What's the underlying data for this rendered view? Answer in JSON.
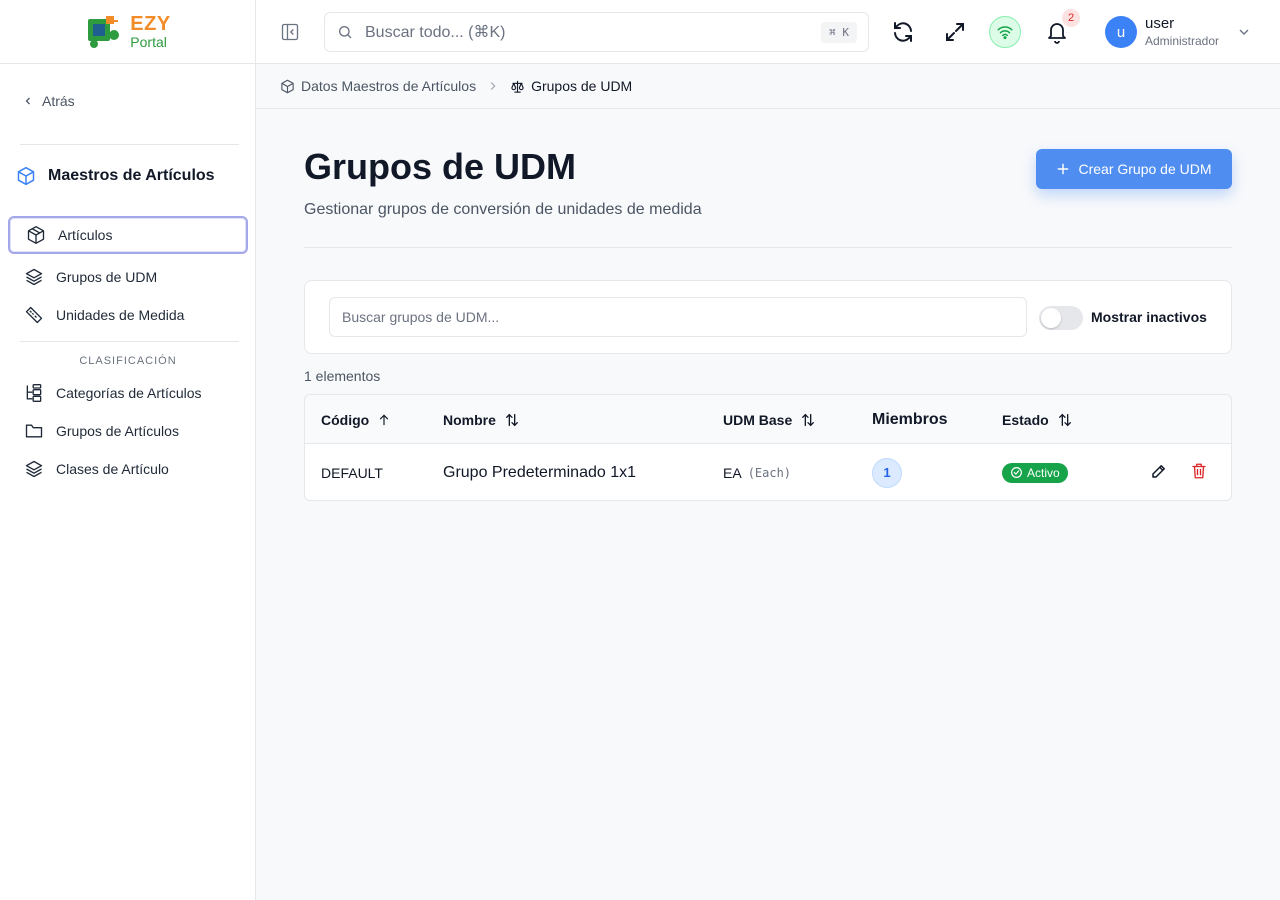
{
  "logo": {
    "line1": "EZY",
    "line2": "Portal"
  },
  "sidebar": {
    "back_label": "Atrás",
    "section_title": "Maestros de Artículos",
    "items": [
      {
        "label": "Artículos",
        "icon": "box-icon",
        "active": true
      },
      {
        "label": "Grupos de UDM",
        "icon": "layers-icon"
      },
      {
        "label": "Unidades de Medida",
        "icon": "ruler-icon"
      }
    ],
    "classification_label": "CLASIFICACIÓN",
    "classification_items": [
      {
        "label": "Categorías de Artículos",
        "icon": "hierarchy-icon"
      },
      {
        "label": "Grupos de Artículos",
        "icon": "folder-icon"
      },
      {
        "label": "Clases de Artículo",
        "icon": "layers-icon"
      }
    ]
  },
  "header": {
    "search_placeholder": "Buscar todo... (⌘K)",
    "shortcut": "⌘ K",
    "notifications_count": "2",
    "user": {
      "initial": "u",
      "name": "user",
      "role": "Administrador"
    }
  },
  "breadcrumb": [
    {
      "label": "Datos Maestros de Artículos",
      "icon": "box-icon"
    },
    {
      "label": "Grupos de UDM",
      "icon": "scale-icon"
    }
  ],
  "page": {
    "title": "Grupos de UDM",
    "subtitle": "Gestionar grupos de conversión de unidades de medida",
    "create_button": "Crear Grupo de UDM"
  },
  "filters": {
    "search_placeholder": "Buscar grupos de UDM...",
    "show_inactive_label": "Mostrar inactivos",
    "show_inactive": false
  },
  "count_label": "1 elementos",
  "table": {
    "columns": [
      "Código",
      "Nombre",
      "UDM Base",
      "Miembros",
      "Estado"
    ],
    "rows": [
      {
        "code": "DEFAULT",
        "name": "Grupo Predeterminado 1x1",
        "base_udm": "EA",
        "base_udm_desc": "(Each)",
        "members": "1",
        "status": "Activo"
      }
    ]
  },
  "colors": {
    "primary": "#4f8ef0",
    "success": "#16a34a",
    "danger": "#dc2626"
  }
}
